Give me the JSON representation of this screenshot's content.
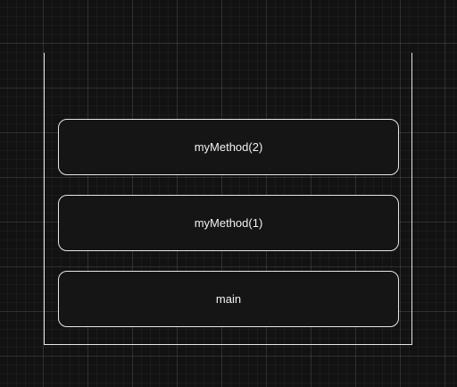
{
  "call_stack": {
    "frames": [
      {
        "label": "myMethod(2)"
      },
      {
        "label": "myMethod(1)"
      },
      {
        "label": "main"
      }
    ]
  }
}
